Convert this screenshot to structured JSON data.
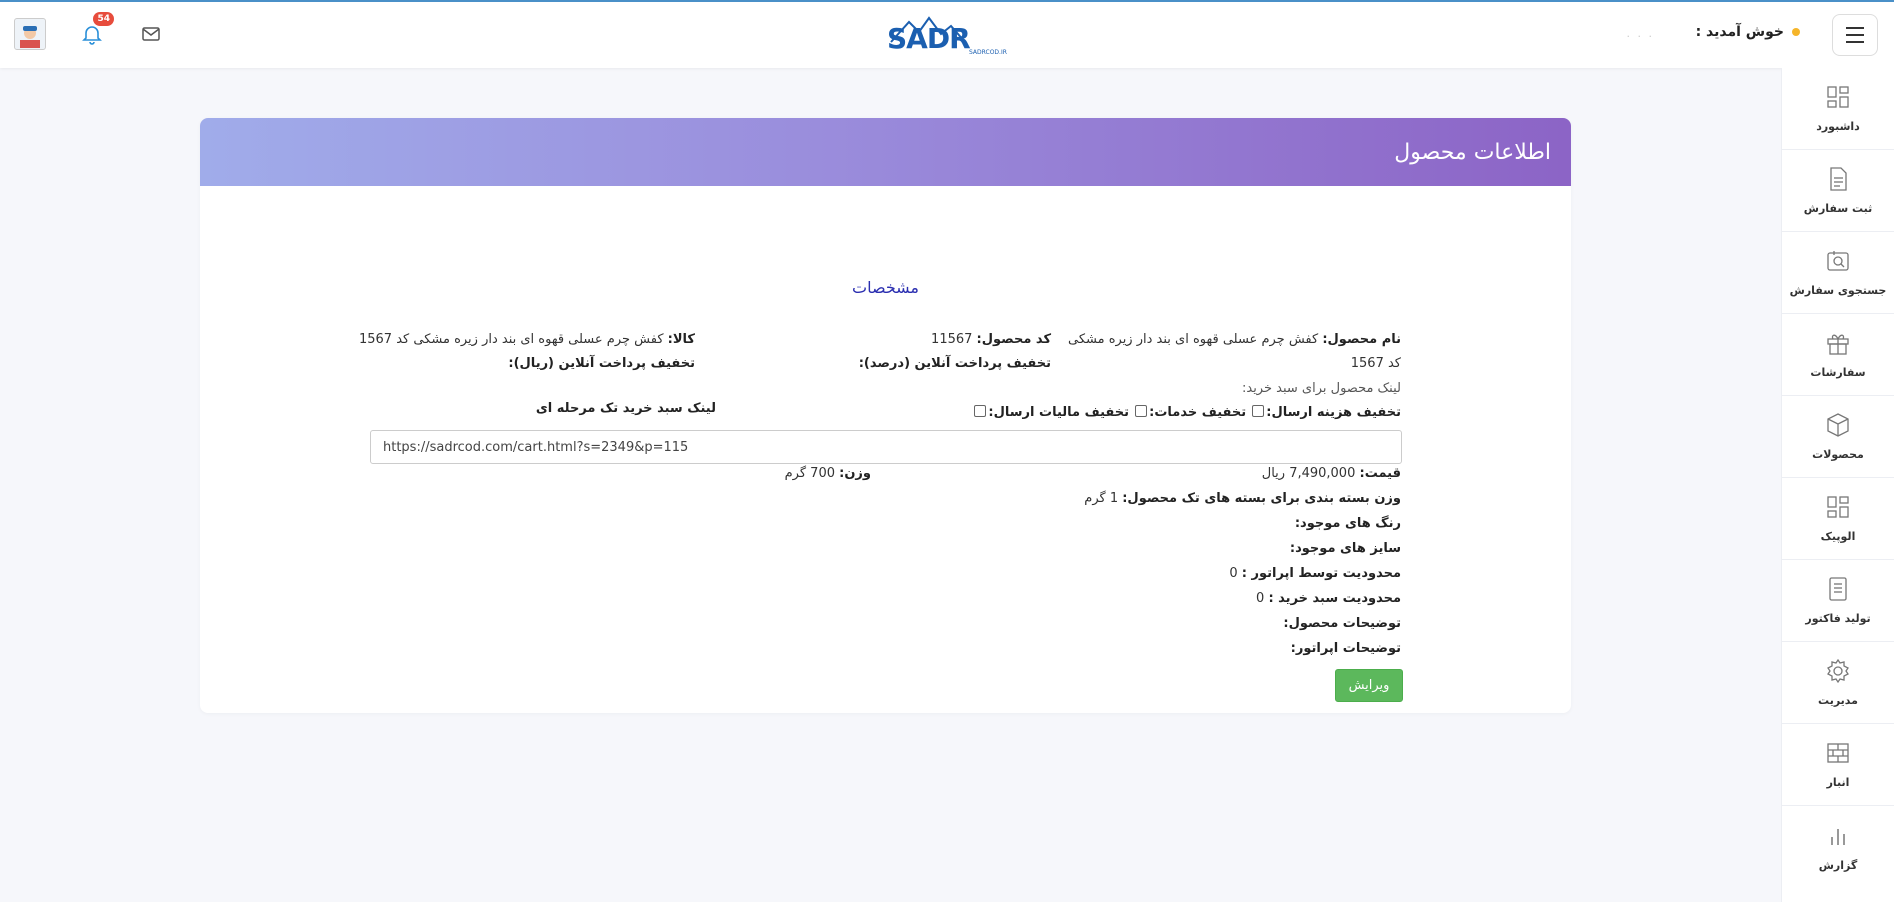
{
  "header": {
    "welcome_text": "خوش آمدید :",
    "user_name": "· · ·",
    "notification_count": "54",
    "logo_text": "SADR",
    "logo_sub": "SADRCOD.IR"
  },
  "sidebar": {
    "items": [
      {
        "label": "داشبورد",
        "icon": "dashboard-icon"
      },
      {
        "label": "ثبت سفارش",
        "icon": "document-icon"
      },
      {
        "label": "جستجوی سفارش",
        "icon": "search-order-icon"
      },
      {
        "label": "سفارشات",
        "icon": "gift-box-icon"
      },
      {
        "label": "محصولات",
        "icon": "cube-icon"
      },
      {
        "label": "الوپیک",
        "icon": "grid-icon"
      },
      {
        "label": "تولید فاکتور",
        "icon": "invoice-icon"
      },
      {
        "label": "مدیریت",
        "icon": "gear-icon"
      },
      {
        "label": "انبار",
        "icon": "warehouse-icon"
      },
      {
        "label": "گزارش",
        "icon": "bar-chart-icon"
      }
    ]
  },
  "card": {
    "title": "اطلاعات محصول",
    "section_title": "مشخصات",
    "product_name_label": "نام محصول:",
    "product_name_value": "کفش چرم عسلی قهوه ای بند دار زیره مشکی",
    "product_name_cont": "کد 1567",
    "product_code_label": "کد محصول:",
    "product_code_value": "11567",
    "goods_label": "کالا:",
    "goods_value": "کفش چرم عسلی قهوه ای بند دار زیره مشکی کد 1567",
    "online_discount_percent_label": "تخفیف پرداخت آنلاین (درصد):",
    "online_discount_rial_label": "تخفیف پرداخت آنلاین (ریال):",
    "cart_link_label": "لینک محصول برای سبد خرید:",
    "shipping_discount_label": "تخفیف هزینه ارسال:",
    "services_discount_label": "تخفیف خدمات:",
    "shipping_tax_discount_label": "تخفیف مالیات ارسال:",
    "single_step_link_label": "لینک سبد خرید تک مرحله ای",
    "cart_link_value": "https://sadrcod.com/cart.html?s=2349&p=115",
    "price_label": "قیمت:",
    "price_value": "7,490,000 ریال",
    "weight_label": "وزن:",
    "weight_value": "700 گرم",
    "package_weight_label": "وزن بسته بندی برای بسته های تک محصول:",
    "package_weight_value": "1 گرم",
    "colors_label": "رنگ های موجود:",
    "sizes_label": "سایز های موجود:",
    "operator_limit_label": "محدودیت توسط اپراتور :",
    "operator_limit_value": "0",
    "cart_limit_label": "محدودیت سبد خرید :",
    "cart_limit_value": "0",
    "product_desc_label": "توضیحات محصول:",
    "operator_desc_label": "توضیحات اپراتور:",
    "edit_button": "ویرایش"
  },
  "colors": {
    "accent_green": "#5cb85c",
    "section_title": "#2a2eb0",
    "header_gradient_start": "#a0acea",
    "header_gradient_end": "#8c64c6",
    "logo_blue": "#1b5fb0"
  }
}
